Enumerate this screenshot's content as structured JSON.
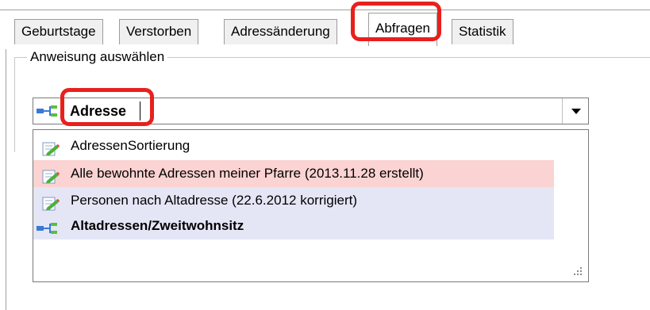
{
  "tabs": [
    {
      "label": "Geburtstage",
      "active": false
    },
    {
      "label": "Verstorben",
      "active": false
    },
    {
      "label": "Adressänderung",
      "active": false
    },
    {
      "label": "Abfragen",
      "active": true
    },
    {
      "label": "Statistik",
      "active": false
    }
  ],
  "group": {
    "label": "Anweisung auswählen"
  },
  "combo": {
    "value": "Adresse",
    "icon": "query-flow-icon"
  },
  "dropdown": {
    "items": [
      {
        "label": "AdressenSortierung",
        "icon": "edit-query-icon",
        "bold": false
      },
      {
        "label": "Alle bewohnte Adressen meiner Pfarre (2013.11.28 erstellt)",
        "icon": "edit-query-icon",
        "bold": false
      },
      {
        "label": "Personen nach Altadresse (22.6.2012 korrigiert)",
        "icon": "edit-query-icon",
        "bold": false
      },
      {
        "label": "Altadressen/Zweitwohnsitz",
        "icon": "query-flow-icon",
        "bold": true
      }
    ]
  },
  "colors": {
    "highlight_red": "#e8201c",
    "row_pink": "#fbd3d3",
    "row_lavender": "#e4e6f6"
  }
}
